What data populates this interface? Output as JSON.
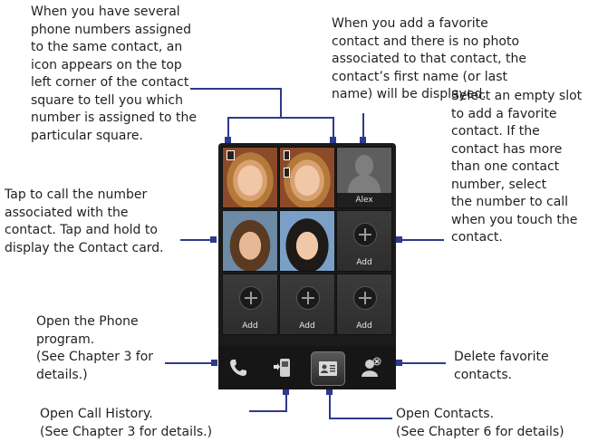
{
  "callouts": {
    "number_icon": "When you have several\nphone numbers assigned\nto the same contact, an\nicon appears on the top\nleft corner of the contact\nsquare to tell you which\nnumber is assigned to the\nparticular square.",
    "no_photo": "When you add a favorite\ncontact and there is no photo\nassociated to that contact, the\ncontact’s first name (or last\nname) will be displayed.",
    "tap_call": "Tap to call the number\nassociated with the\ncontact. Tap and hold to\ndisplay the Contact card.",
    "empty_slot": "Select an empty slot\nto add a favorite\ncontact. If the\ncontact has more\nthan one contact\nnumber, select\nthe number to call\nwhen you touch the\ncontact.",
    "phone_program": "Open the Phone\nprogram.\n(See Chapter 3 for\ndetails.)",
    "delete_favorite": "Delete favorite\ncontacts.",
    "call_history": "Open Call History.\n(See Chapter 3 for details.)",
    "contacts": "Open Contacts.\n(See Chapter 6 for details)"
  },
  "grid": {
    "contact_name": "Alex",
    "add_label": "Add"
  },
  "colors": {
    "leader_line": "#2e3a8c",
    "device_background": "#1b1b1b"
  },
  "icons": [
    "phone-icon",
    "call-history-icon",
    "contacts-card-icon",
    "delete-contact-icon",
    "plus-icon",
    "number-indicator-icon"
  ]
}
